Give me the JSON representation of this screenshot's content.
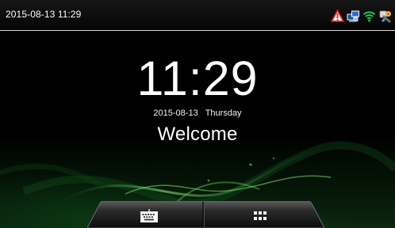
{
  "status_bar": {
    "datetime": "2015-08-13 11:29",
    "icons": [
      "alarm-warning-icon",
      "network-link-icon",
      "wifi-icon",
      "tools-icon"
    ]
  },
  "home": {
    "time": "11:29",
    "date": "2015-08-13",
    "weekday": "Thursday",
    "greeting": "Welcome"
  },
  "dock": {
    "buttons": [
      "keyboard-icon",
      "menu-grid-icon"
    ]
  },
  "colors": {
    "background": "#000000",
    "text": "#ffffff",
    "accent_green": "#28a33d",
    "warning_red": "#e51b23",
    "wifi_green": "#20c34a",
    "network_blue": "#2b6ccb"
  }
}
